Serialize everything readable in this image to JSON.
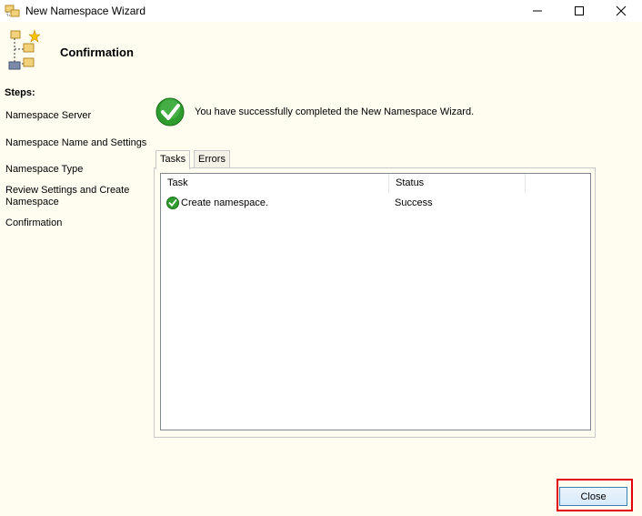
{
  "window": {
    "title": "New Namespace Wizard"
  },
  "header": {
    "title": "Confirmation"
  },
  "steps": {
    "heading": "Steps:",
    "items": [
      {
        "label": "Namespace Server"
      },
      {
        "label": "Namespace Name and Settings"
      },
      {
        "label": "Namespace Type"
      },
      {
        "label": "Review Settings and Create Namespace"
      },
      {
        "label": "Confirmation"
      }
    ]
  },
  "main": {
    "message": "You have successfully completed the New Namespace Wizard.",
    "tabs": [
      {
        "label": "Tasks"
      },
      {
        "label": "Errors"
      }
    ],
    "table": {
      "columns": [
        "Task",
        "Status"
      ],
      "rows": [
        {
          "task": "Create namespace.",
          "status": "Success",
          "icon": "success-check-icon"
        }
      ]
    }
  },
  "footer": {
    "close_label": "Close"
  },
  "colors": {
    "highlight": "#e30000",
    "background": "#fffdf0",
    "success": "#2e9d2e"
  }
}
